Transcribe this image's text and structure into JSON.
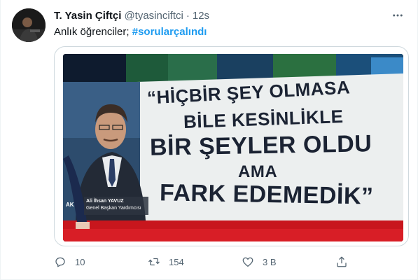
{
  "tweet": {
    "display_name": "T. Yasin Çiftçi",
    "handle": "@tyasinciftci",
    "separator": "·",
    "time": "12s",
    "text": "Anlık öğrenciler;",
    "hashtag": "#sorularçalındı"
  },
  "media": {
    "quote_lines": [
      "“HİÇBİR ŞEY OLMASA",
      "BİLE KESİNLİKLE",
      "BİR ŞEYLER OLDU",
      "AMA",
      "FARK EDEMEDİK”"
    ],
    "lower_third_name": "Ali İhsan YAVUZ",
    "lower_third_title": "Genel Başkan Yardımcısı",
    "corner_text": "AK"
  },
  "actions": {
    "reply_count": "10",
    "retweet_count": "154",
    "like_count": "3 B",
    "icons": [
      "reply-icon",
      "retweet-icon",
      "like-icon",
      "share-icon"
    ]
  },
  "colors": {
    "accent": "#1d9bf0",
    "secondary_text": "#536471",
    "primary_text": "#0f1419",
    "border": "#cfd9de"
  }
}
